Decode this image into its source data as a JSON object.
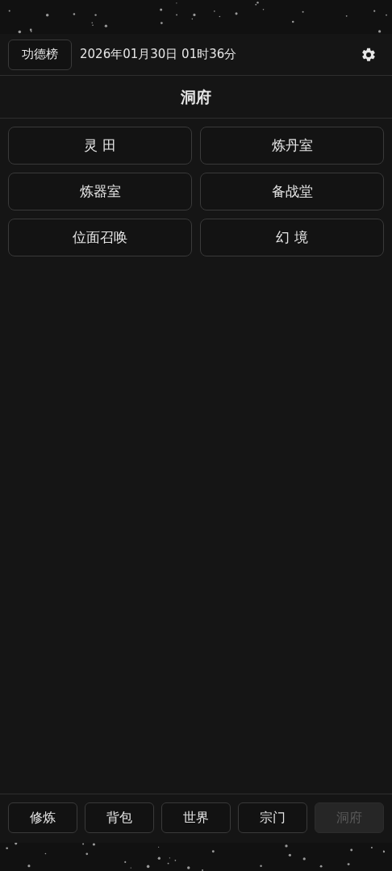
{
  "header": {
    "leaderboard_button": "功德榜",
    "datetime": "2026年01月30日 01时36分"
  },
  "title": "洞府",
  "rooms": [
    {
      "label": "灵 田"
    },
    {
      "label": "炼丹室"
    },
    {
      "label": "炼器室"
    },
    {
      "label": "备战堂"
    },
    {
      "label": "位面召唤"
    },
    {
      "label": "幻 境"
    }
  ],
  "nav": [
    {
      "label": "修炼",
      "selected": false
    },
    {
      "label": "背包",
      "selected": false
    },
    {
      "label": "世界",
      "selected": false
    },
    {
      "label": "宗门",
      "selected": false
    },
    {
      "label": "洞府",
      "selected": true
    }
  ]
}
